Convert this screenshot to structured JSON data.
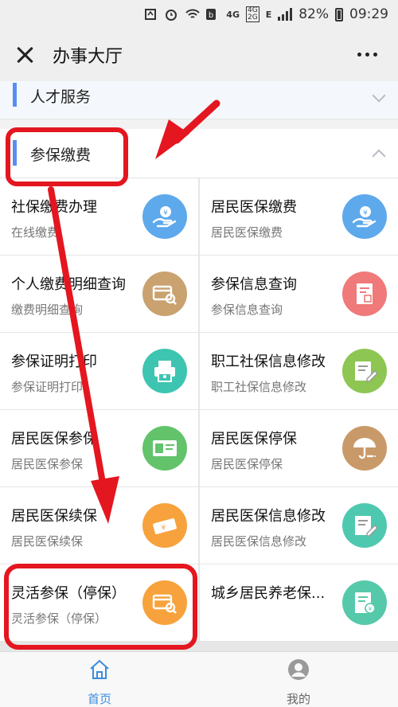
{
  "status_bar": {
    "network_1": "4G",
    "network_2a": "4G",
    "network_2b": "2G",
    "network_3": "E",
    "battery": "82%",
    "time": "09:29"
  },
  "header": {
    "title": "办事大厅"
  },
  "sections": {
    "talent": {
      "label": "人才服务"
    },
    "insurance": {
      "label": "参保缴费"
    }
  },
  "services": [
    {
      "title": "社保缴费办理",
      "subtitle": "在线缴费",
      "icon": "hand-coin-icon",
      "color": "#5ea9ec"
    },
    {
      "title": "居民医保缴费",
      "subtitle": "居民医保缴费",
      "icon": "hand-coin-icon",
      "color": "#5ea9ec"
    },
    {
      "title": "个人缴费明细查询",
      "subtitle": "缴费明细查询",
      "icon": "card-search-icon",
      "color": "#c9a270"
    },
    {
      "title": "参保信息查询",
      "subtitle": "参保信息查询",
      "icon": "document-stamp-icon",
      "color": "#f0797a"
    },
    {
      "title": "参保证明打印",
      "subtitle": "参保证明打印",
      "icon": "printer-icon",
      "color": "#3ec5b1"
    },
    {
      "title": "职工社保信息修改",
      "subtitle": "职工社保信息修改",
      "icon": "edit-form-icon",
      "color": "#8dc653"
    },
    {
      "title": "居民医保参保",
      "subtitle": "居民医保参保",
      "icon": "id-card-icon",
      "color": "#62c36b"
    },
    {
      "title": "居民医保停保",
      "subtitle": "居民医保停保",
      "icon": "umbrella-icon",
      "color": "#c99a69"
    },
    {
      "title": "居民医保续保",
      "subtitle": "居民医保续保",
      "icon": "ticket-icon",
      "color": "#f7a23c"
    },
    {
      "title": "居民医保信息修改",
      "subtitle": "居民医保信息修改",
      "icon": "edit-form-icon",
      "color": "#4fc8b0"
    },
    {
      "title": "灵活参保（停保）",
      "subtitle": "灵活参保（停保）",
      "icon": "card-search-icon",
      "color": "#f7a23c"
    },
    {
      "title": "城乡居民养老保...",
      "subtitle": "",
      "icon": "pension-form-icon",
      "color": "#55c9a9"
    }
  ],
  "tabbar": {
    "home_label": "首页",
    "mine_label": "我的",
    "active_color": "#3b8ce0"
  }
}
